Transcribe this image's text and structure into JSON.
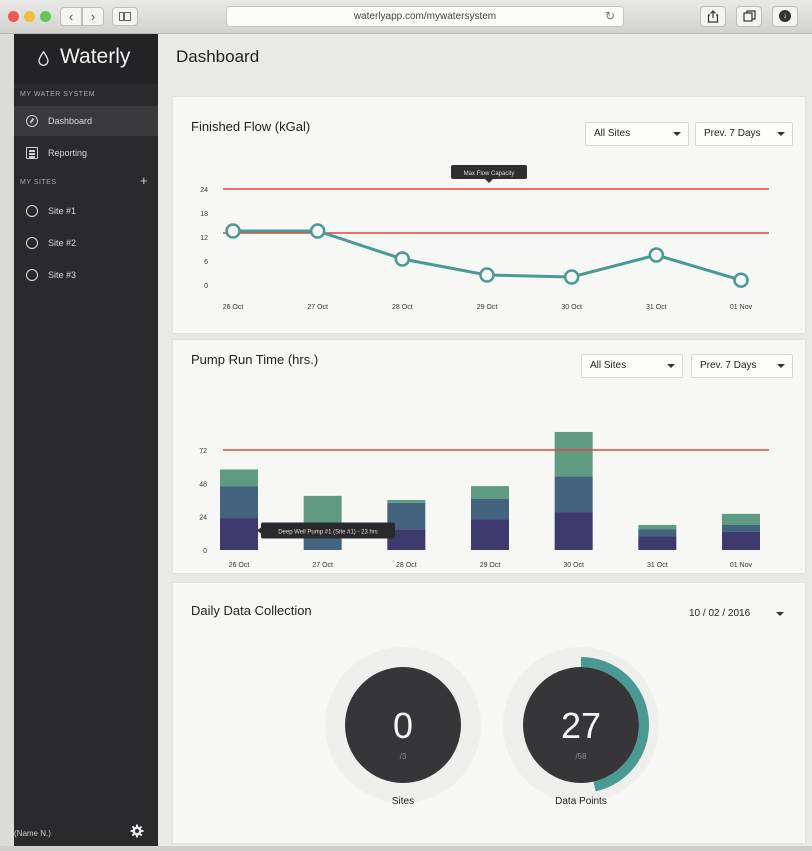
{
  "browser": {
    "url": "waterlyapp.com/mywatersystem",
    "back": "‹",
    "forward": "›"
  },
  "sidebar": {
    "brand": "Waterly",
    "section_system": "MY WATER SYSTEM",
    "nav": [
      {
        "label": "Dashboard",
        "icon": "gauge-icon",
        "active": true
      },
      {
        "label": "Reporting",
        "icon": "report-icon",
        "active": false
      }
    ],
    "section_sites": "MY SITES",
    "add_label": "+",
    "sites": [
      {
        "label": "Site #1"
      },
      {
        "label": "Site #2"
      },
      {
        "label": "Site #3"
      }
    ],
    "user_name": "(Name N.)"
  },
  "main": {
    "title": "Dashboard"
  },
  "flow_card": {
    "title": "Finished Flow (kGal)",
    "site_select": "All Sites",
    "range_select": "Prev. 7 Days",
    "tooltip": "Max Flow Capacity"
  },
  "pump_card": {
    "title": "Pump Run Time (hrs.)",
    "site_select": "All Sites",
    "range_select": "Prev. 7 Days",
    "tooltip": "Deep Well Pump #1 (Site #1) - 23 hrs"
  },
  "collection_card": {
    "title": "Daily Data Collection",
    "date_select": "10 / 02 / 2016",
    "sites": {
      "value": "0",
      "total": "/3",
      "label": "Sites",
      "fraction": 0
    },
    "points": {
      "value": "27",
      "total": "/58",
      "label": "Data Points",
      "fraction": 0.4655
    }
  },
  "colors": {
    "sidebar": "#2a2a2c",
    "line": "#4a9a94",
    "threshold": "#e0463a",
    "bar_dark": "#3e3a6e",
    "bar_mid": "#44637f",
    "bar_light": "#5f9b82",
    "dial": "#363638",
    "ring_teal": "#4a9a94"
  },
  "chart_data": [
    {
      "type": "line",
      "title": "Finished Flow (kGal)",
      "categories": [
        "26 Oct",
        "27 Oct",
        "28 Oct",
        "29 Oct",
        "30 Oct",
        "31 Oct",
        "01 Nov"
      ],
      "yticks": [
        "24",
        "18",
        "12",
        "6",
        "0"
      ],
      "values": [
        13.5,
        13.5,
        6.5,
        2.5,
        2,
        7.5,
        1.2
      ],
      "thresholds": [
        {
          "label": "Max Flow Capacity",
          "value": 24
        },
        {
          "value": 13
        }
      ],
      "ylim": [
        0,
        24
      ],
      "grid": false
    },
    {
      "type": "bar",
      "title": "Pump Run Time (hrs.)",
      "stacked": true,
      "categories": [
        "26 Oct",
        "27 Oct",
        "28 Oct",
        "29 Oct",
        "30 Oct",
        "31 Oct",
        "01 Nov"
      ],
      "yticks": [
        "72",
        "48",
        "24",
        "0"
      ],
      "series": [
        {
          "values": [
            23,
            0,
            15,
            22,
            27,
            10,
            13
          ]
        },
        {
          "values": [
            23,
            10,
            19,
            15,
            26,
            5,
            5
          ]
        },
        {
          "values": [
            12,
            29,
            2,
            9,
            32,
            3,
            8
          ]
        }
      ],
      "thresholds": [
        {
          "value": 72
        }
      ],
      "ylim": [
        0,
        72
      ],
      "grid": false
    }
  ]
}
